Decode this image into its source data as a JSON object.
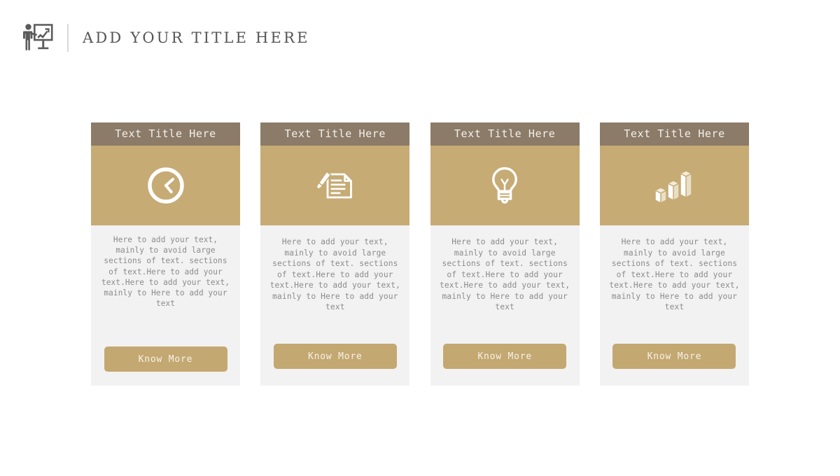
{
  "header": {
    "icon": "presenter-chart-board-icon",
    "title": "ADD YOUR TITLE HERE",
    "divider_color": "#d8d8d8",
    "title_color": "#555555"
  },
  "theme": {
    "title_bar_color": "#8b7b68",
    "icon_panel_color": "#c6ab75",
    "button_color": "#c4a871",
    "card_body_color": "#f2f2f2",
    "page_background": "#ffffff"
  },
  "cards": [
    {
      "title": "Text Title Here",
      "icon": "clock-icon",
      "text": "Here to add your text, mainly to avoid large sections of text. sections of text.Here to add your text.Here to add your text, mainly to Here to add your text",
      "button_label": "Know More"
    },
    {
      "title": "Text Title Here",
      "icon": "pen-document-icon",
      "text": "Here to add your text, mainly to avoid large sections of text. sections of text.Here to add your text.Here to add your text, mainly to Here to add your text",
      "button_label": "Know More"
    },
    {
      "title": "Text Title Here",
      "icon": "lightbulb-icon",
      "text": "Here to add your text, mainly to avoid large sections of text. sections of text.Here to add your text.Here to add your text, mainly to Here to add your text",
      "button_label": "Know More"
    },
    {
      "title": "Text Title Here",
      "icon": "bar-chart-3d-icon",
      "text": "Here to add your text, mainly to avoid large sections of text. sections of text.Here to add your text.Here to add your text, mainly to Here to add your text",
      "button_label": "Know More"
    }
  ]
}
